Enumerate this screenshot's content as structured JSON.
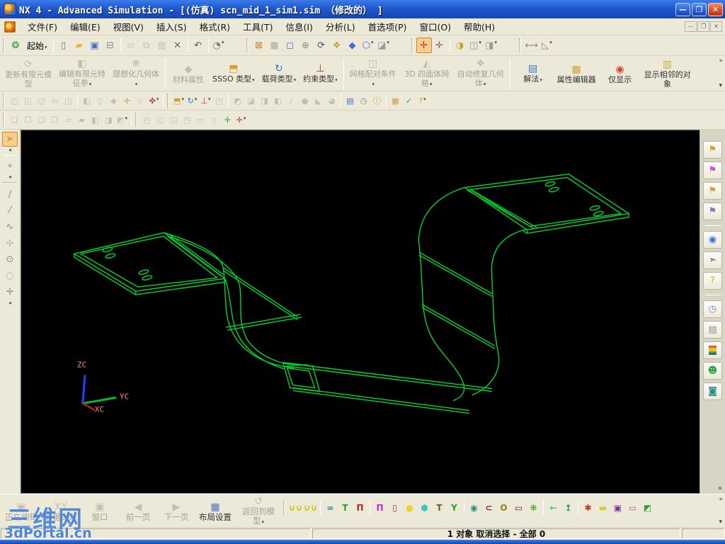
{
  "window": {
    "title": "NX 4 - Advanced Simulation - [(仿真) scn_mid_1_sim1.sim （修改的） ]",
    "buttons": {
      "minimize": "—",
      "restore": "❐",
      "close": "✕"
    }
  },
  "menu": {
    "items": [
      {
        "n": "menu-file",
        "t": "menu",
        "label": "文件(F)"
      },
      {
        "n": "menu-edit",
        "t": "menu",
        "label": "编辑(E)"
      },
      {
        "n": "menu-view",
        "t": "menu",
        "label": "视图(V)"
      },
      {
        "n": "menu-insert",
        "t": "menu",
        "label": "插入(S)"
      },
      {
        "n": "menu-format",
        "t": "menu",
        "label": "格式(R)"
      },
      {
        "n": "menu-tools",
        "t": "menu",
        "label": "工具(T)"
      },
      {
        "n": "menu-information",
        "t": "menu",
        "label": "信息(I)"
      },
      {
        "n": "menu-analysis",
        "t": "menu",
        "label": "分析(L)"
      },
      {
        "n": "menu-preferences",
        "t": "menu",
        "label": "首选项(P)"
      },
      {
        "n": "menu-window",
        "t": "menu",
        "label": "窗口(O)"
      },
      {
        "n": "menu-help",
        "t": "menu",
        "label": "帮助(H)"
      }
    ],
    "mdi": {
      "min": "—",
      "restore": "❐",
      "close": "✕"
    }
  },
  "toolbar_std": {
    "items": [
      {
        "t": "grip"
      },
      {
        "n": "nx-logo",
        "g": "❂",
        "c": "#2f9e44"
      },
      {
        "n": "start-menu",
        "t": "label",
        "label": "起始",
        "dd": true
      },
      {
        "t": "sep"
      },
      {
        "n": "new-file",
        "g": "▯",
        "c": "#7a7a7a"
      },
      {
        "n": "open-file",
        "g": "▰",
        "c": "#e3b73a"
      },
      {
        "n": "save",
        "g": "▣",
        "c": "#4a6fc4"
      },
      {
        "n": "print",
        "g": "⊟",
        "c": "#8a8a8a"
      },
      {
        "t": "sep"
      },
      {
        "n": "cut",
        "g": "▱",
        "c": "#c2beb2",
        "d": true
      },
      {
        "n": "copy",
        "g": "⧉",
        "c": "#c2beb2",
        "d": true
      },
      {
        "n": "paste",
        "g": "▥",
        "c": "#c2beb2",
        "d": true
      },
      {
        "n": "delete",
        "g": "✕",
        "c": "#666666"
      },
      {
        "t": "sep"
      },
      {
        "n": "undo",
        "g": "↶",
        "c": "#555555"
      },
      {
        "t": "sep"
      },
      {
        "n": "object-info",
        "g": "◔",
        "c": "#777777",
        "dd": true
      },
      {
        "t": "gap"
      },
      {
        "t": "grip"
      },
      {
        "n": "fit-view",
        "g": "⊠",
        "c": "#e07820"
      },
      {
        "n": "zoom-disabled",
        "g": "■",
        "c": "#c2beb2",
        "d": true
      },
      {
        "n": "zoom-window",
        "g": "◻",
        "c": "#4a6fc4"
      },
      {
        "n": "zoom-in-out",
        "g": "⊕",
        "c": "#8a8a8a"
      },
      {
        "n": "rotate-view",
        "g": "⟳",
        "c": "#555555"
      },
      {
        "n": "pan-view",
        "g": "❖",
        "c": "#c9a23a"
      },
      {
        "n": "shaded-view",
        "g": "◆",
        "c": "#3b6fd4"
      },
      {
        "n": "wireframe-view",
        "g": "⬡",
        "c": "#7a5ad0",
        "dd": true
      },
      {
        "n": "hidden-edges-view",
        "g": "◪",
        "c": "#9a9a9a",
        "dd": true
      },
      {
        "t": "gap"
      },
      {
        "t": "grip"
      },
      {
        "n": "wcs-dynamics",
        "g": "✛",
        "c": "#c03030",
        "hl": true
      },
      {
        "n": "wcs-orient",
        "g": "✛",
        "c": "#8a5a5a"
      },
      {
        "t": "sep"
      },
      {
        "n": "visualization",
        "g": "◑",
        "c": "#c9a23a"
      },
      {
        "n": "visual-pref-1",
        "g": "◫",
        "c": "#9a9a9a",
        "dd": true
      },
      {
        "n": "visual-pref-2",
        "g": "◨",
        "c": "#9a9a9a",
        "dd": true
      },
      {
        "t": "gap"
      },
      {
        "t": "grip"
      },
      {
        "n": "measure-distance",
        "g": "⟷",
        "c": "#8a8a8a"
      },
      {
        "n": "measure-angle",
        "g": "◺",
        "c": "#c08040",
        "dd": true
      }
    ]
  },
  "toolbar_sim": {
    "buttons": [
      {
        "n": "update-fe-model",
        "label": "更新有限元模型",
        "g": "⟳",
        "d": true
      },
      {
        "n": "edit-fe-params",
        "label": "编辑有限元特征参",
        "g": "◧",
        "d": true,
        "dd": true
      },
      {
        "n": "idealize-geometry",
        "label": "理想化几何体",
        "g": "❋",
        "d": true,
        "dd": true
      },
      {
        "t": "sep"
      },
      {
        "n": "material-properties",
        "label": "材料属性",
        "g": "◆",
        "d": true
      },
      {
        "n": "ssso-type",
        "label": "SSSO 类型",
        "g": "⬒",
        "c": "#d8a020",
        "dd": true
      },
      {
        "n": "load-type",
        "label": "载荷类型",
        "g": "↻",
        "c": "#3b6fd4",
        "dd": true
      },
      {
        "n": "constraint-type",
        "label": "约束类型",
        "g": "⊥",
        "c": "#b03030",
        "dd": true
      },
      {
        "t": "sep"
      },
      {
        "n": "mesh-mating-condition",
        "label": "网格配对条件",
        "g": "◫",
        "d": true,
        "dd": true
      },
      {
        "n": "tet-mesh-3d",
        "label": "3D 四面体网格",
        "g": "◭",
        "d": true,
        "dd": true
      },
      {
        "n": "auto-repair-geometry",
        "label": "自动修复几何体",
        "g": "❖",
        "d": true,
        "dd": true
      },
      {
        "t": "sep"
      },
      {
        "n": "solution",
        "label": "解法",
        "g": "▤",
        "c": "#3b6fd4",
        "dd": true
      },
      {
        "n": "property-editor",
        "label": "属性编辑器",
        "g": "▦",
        "c": "#c9a23a"
      },
      {
        "n": "display-only",
        "label": "仅显示",
        "g": "◉",
        "c": "#d04040"
      },
      {
        "n": "show-adjacent-objects",
        "label": "显示相邻的对象",
        "g": "▥",
        "c": "#c9b23a"
      }
    ],
    "more": "»",
    "dd": "▾"
  },
  "toolbar_row4": {
    "items": [
      {
        "t": "grip"
      },
      {
        "n": "fe-op-1",
        "g": "◰",
        "c": "#c2beb2",
        "d": true
      },
      {
        "n": "fe-op-2",
        "g": "◱",
        "c": "#c2beb2",
        "d": true
      },
      {
        "n": "fe-op-3",
        "g": "◲",
        "c": "#c2beb2",
        "d": true
      },
      {
        "n": "fe-op-4",
        "g": "▭",
        "c": "#c2beb2",
        "d": true
      },
      {
        "n": "fe-op-5",
        "g": "◫",
        "c": "#c2beb2",
        "d": true
      },
      {
        "t": "sep"
      },
      {
        "n": "sketch",
        "g": "◧",
        "c": "#c2beb2",
        "d": true
      },
      {
        "n": "datum-plane",
        "g": "▯",
        "c": "#c2beb2",
        "d": true
      },
      {
        "n": "datum-axis",
        "g": "◆",
        "c": "#c2beb2",
        "d": true
      },
      {
        "n": "point",
        "g": "✛",
        "c": "#c9a23a"
      },
      {
        "n": "point-set",
        "g": "⊹",
        "c": "#c2beb2",
        "d": true
      },
      {
        "n": "datum-csys",
        "g": "✜",
        "c": "#b03030",
        "dd": true
      },
      {
        "t": "sep"
      },
      {
        "t": "grip"
      },
      {
        "n": "ssso-small",
        "g": "⬒",
        "c": "#d8a020",
        "dd": true
      },
      {
        "n": "load-small",
        "g": "↻",
        "c": "#3b6fd4",
        "dd": true
      },
      {
        "n": "constraint-small",
        "g": "⊥",
        "c": "#b03030",
        "dd": true
      },
      {
        "n": "sim-object",
        "g": "◳",
        "c": "#c2beb2",
        "d": true
      },
      {
        "t": "sep"
      },
      {
        "n": "mesh-1",
        "g": "◩",
        "c": "#c2beb2",
        "d": true
      },
      {
        "n": "mesh-2",
        "g": "◪",
        "c": "#c2beb2",
        "d": true
      },
      {
        "n": "mesh-3",
        "g": "◨",
        "c": "#c2beb2",
        "d": true
      },
      {
        "n": "mesh-4",
        "g": "◧",
        "c": "#c2beb2",
        "d": true
      },
      {
        "n": "curve-mesh",
        "g": "∕",
        "c": "#c2beb2",
        "d": true
      },
      {
        "n": "sphere-mesh",
        "g": "●",
        "c": "#c2beb2",
        "d": true
      },
      {
        "n": "face-mesh",
        "g": "◣",
        "c": "#c2beb2",
        "d": true
      },
      {
        "n": "body-mesh",
        "g": "◕",
        "c": "#c2beb2",
        "d": true
      },
      {
        "t": "sep"
      },
      {
        "n": "solution-small",
        "g": "▤",
        "c": "#3b6fd4"
      },
      {
        "n": "solve-job",
        "g": "◷",
        "c": "#8a8a8a"
      },
      {
        "n": "job-monitor",
        "g": "ⓘ",
        "c": "#c9a23a"
      },
      {
        "t": "sep"
      },
      {
        "n": "report",
        "g": "▦",
        "c": "#c9a23a"
      },
      {
        "n": "model-check",
        "g": "✓",
        "c": "#2f9e44"
      },
      {
        "n": "context-help",
        "g": "?",
        "c": "#d4b020",
        "dd": true
      }
    ]
  },
  "toolbar_row5": {
    "items": [
      {
        "t": "grip"
      },
      {
        "n": "mesh-tool-1",
        "g": "❏",
        "c": "#c2beb2",
        "d": true
      },
      {
        "n": "mesh-tool-2",
        "g": "❐",
        "c": "#c2beb2",
        "d": true
      },
      {
        "n": "mesh-tool-3",
        "g": "❑",
        "c": "#c2beb2",
        "d": true
      },
      {
        "n": "mesh-tool-4",
        "g": "❒",
        "c": "#c2beb2",
        "d": true
      },
      {
        "n": "mesh-tool-5",
        "g": "▱",
        "c": "#c2beb2",
        "d": true
      },
      {
        "n": "mesh-tool-6",
        "g": "▰",
        "c": "#c2beb2",
        "d": true
      },
      {
        "n": "mesh-tool-7",
        "g": "◧",
        "c": "#c2beb2",
        "d": true
      },
      {
        "n": "mesh-tool-8",
        "g": "◨",
        "c": "#c2beb2",
        "d": true
      },
      {
        "n": "mesh-tool-9",
        "g": "◩",
        "c": "#c2beb2",
        "d": true,
        "dd": true
      },
      {
        "t": "sep"
      },
      {
        "t": "grip"
      },
      {
        "n": "bc-tool-1",
        "g": "◰",
        "c": "#c2beb2",
        "d": true
      },
      {
        "n": "bc-tool-2",
        "g": "◱",
        "c": "#c2beb2",
        "d": true
      },
      {
        "n": "bc-tool-3",
        "g": "◲",
        "c": "#c2beb2",
        "d": true
      },
      {
        "n": "bc-tool-4",
        "g": "◳",
        "c": "#c2beb2",
        "d": true
      },
      {
        "n": "bc-tool-5",
        "g": "▭",
        "c": "#c2beb2",
        "d": true
      },
      {
        "n": "bc-tool-6",
        "g": "▯",
        "c": "#c2beb2",
        "d": true
      },
      {
        "n": "csys-display",
        "g": "✛",
        "c": "#2f9e44"
      },
      {
        "n": "csys-wcs-display",
        "g": "✛",
        "c": "#c03030",
        "dd": true
      }
    ]
  },
  "left_toolbar": {
    "items": [
      {
        "n": "selection-filter",
        "g": "➤",
        "c": "#c9a23a",
        "hl": true
      },
      {
        "t": "arrow"
      },
      {
        "t": "sep"
      },
      {
        "n": "snap-point",
        "g": "⌖",
        "c": "#9a968a",
        "d": true
      },
      {
        "t": "arrow"
      },
      {
        "t": "grip"
      },
      {
        "n": "snap-line",
        "g": "∕",
        "c": "#8a8a8a"
      },
      {
        "n": "snap-line-segment",
        "g": "⁄",
        "c": "#8a8a8a"
      },
      {
        "n": "snap-spline",
        "g": "∿",
        "c": "#8a8a8a"
      },
      {
        "n": "snap-axis",
        "g": "⊹",
        "c": "#8a8a8a"
      },
      {
        "n": "snap-circle-center",
        "g": "⊙",
        "c": "#8a8a8a"
      },
      {
        "n": "snap-circle",
        "g": "◌",
        "c": "#8a8a8a"
      },
      {
        "n": "snap-cross",
        "g": "✛",
        "c": "#8a8a8a"
      },
      {
        "t": "arrow"
      }
    ]
  },
  "resource_bar": {
    "items": [
      {
        "n": "simulation-navigator",
        "g": "⚑",
        "c": "#c9a23a"
      },
      {
        "n": "assembly-navigator",
        "g": "⚑",
        "c": "#d050d0"
      },
      {
        "n": "part-navigator",
        "g": "⚑",
        "c": "#c9a23a"
      },
      {
        "n": "constraint-navigator",
        "g": "⚑",
        "c": "#9a6ad0"
      },
      {
        "t": "sep"
      },
      {
        "n": "web-browser",
        "g": "◉",
        "c": "#3b6fd4"
      },
      {
        "n": "history-palette",
        "g": "➣",
        "c": "#555555"
      },
      {
        "n": "help-bookmark",
        "g": "?",
        "c": "#d4b020"
      },
      {
        "t": "sep"
      },
      {
        "n": "system-scene",
        "g": "◷",
        "c": "#7a8ac0"
      },
      {
        "n": "notebook",
        "g": "▤",
        "c": "#8a8a8a"
      },
      {
        "n": "color-palette",
        "g": "",
        "c": "rainbow"
      },
      {
        "n": "user-roles",
        "g": "☻",
        "c": "#2f9e44"
      },
      {
        "n": "visual-reports",
        "g": "◙",
        "c": "#309090"
      }
    ],
    "more": "»"
  },
  "viewport": {
    "model_color": "#00d42f",
    "axes": {
      "z": "ZC",
      "y": "YC",
      "x": "XC",
      "label_color": "#ff8878"
    }
  },
  "bottom_toolbar": {
    "buttons": [
      {
        "n": "editing-layout",
        "label": "正在编辑",
        "g": "▣",
        "d": true
      },
      {
        "n": "xy-data-tracking",
        "label": "数据跟踪",
        "g": "XY",
        "d": true
      },
      {
        "n": "window-page",
        "label": "窗口",
        "g": "▣",
        "d": true
      },
      {
        "n": "prev-page",
        "label": "前一页",
        "g": "◀",
        "c": "#5aa06a",
        "d": true
      },
      {
        "n": "next-page",
        "label": "下一页",
        "g": "▶",
        "c": "#5aa06a",
        "d": true
      },
      {
        "n": "layout-settings",
        "label": "布局设置",
        "g": "▦",
        "c": "#4a6fc4"
      },
      {
        "n": "return-to-model",
        "label": "返回到模型",
        "g": "↺",
        "d": true,
        "dd": true
      }
    ],
    "icons": [
      {
        "t": "grip"
      },
      {
        "n": "clamp-load-1",
        "g": "∪∪",
        "c": "#d4c400"
      },
      {
        "n": "clamp-load-2",
        "g": "∪∪",
        "c": "#d4c400"
      },
      {
        "t": "sep"
      },
      {
        "n": "link-connection",
        "g": "∞",
        "c": "#208888"
      },
      {
        "n": "fixed-support",
        "g": "T",
        "c": "#20a020"
      },
      {
        "n": "simple-support",
        "g": "Π",
        "c": "#c02020"
      },
      {
        "t": "sep"
      },
      {
        "n": "pinned-support",
        "g": "Π",
        "c": "#d020d0"
      },
      {
        "n": "cage-constraint",
        "g": "▯",
        "c": "#c03030"
      },
      {
        "n": "bearing-load",
        "g": "●",
        "c": "#e8d820"
      },
      {
        "n": "hydrostatic-load",
        "g": "⬢",
        "c": "#30c8c8"
      },
      {
        "n": "slider-support",
        "g": "T",
        "c": "#706020"
      },
      {
        "n": "cylindrical-joint",
        "g": "Y",
        "c": "#20a030"
      },
      {
        "t": "sep"
      },
      {
        "n": "rotational-load",
        "g": "◉",
        "c": "#209080"
      },
      {
        "n": "c-clip-constraint",
        "g": "⊂",
        "c": "#902020"
      },
      {
        "n": "ring-load",
        "g": "O",
        "c": "#908020"
      },
      {
        "n": "capsule-load",
        "g": "▭",
        "c": "#902020"
      },
      {
        "n": "gear-load",
        "g": "❋",
        "c": "#30b030"
      },
      {
        "t": "sep"
      },
      {
        "n": "enforced-displacement",
        "g": "←",
        "c": "#30b8c8"
      },
      {
        "n": "force-load",
        "g": "↥",
        "c": "#208888"
      },
      {
        "t": "sep"
      },
      {
        "n": "wheel-load",
        "g": "✱",
        "c": "#c03030"
      },
      {
        "n": "bar-load",
        "g": "▬",
        "c": "#ddcc20"
      },
      {
        "n": "region-constraint",
        "g": "▣",
        "c": "#8030a0"
      },
      {
        "n": "capsule-constraint",
        "g": "▭",
        "c": "#d06080"
      },
      {
        "n": "flag-marker",
        "g": "◩",
        "c": "#30a030"
      }
    ],
    "more": "»",
    "dd": "▾"
  },
  "status_bar": {
    "text": "1 对象 取消选择  - 全部 0"
  },
  "watermark": {
    "line1": "三维网",
    "line2": "3dPortal.cn"
  }
}
